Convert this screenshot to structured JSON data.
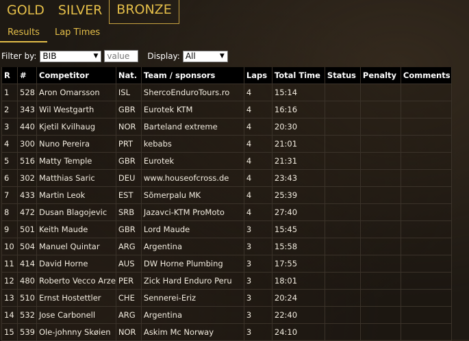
{
  "class_tabs": [
    "GOLD",
    "SILVER",
    "BRONZE"
  ],
  "active_class": "BRONZE",
  "sub_tabs": [
    "Results",
    "Lap Times"
  ],
  "filter": {
    "label": "Filter by:",
    "field_value": "BIB",
    "value_placeholder": "value",
    "display_label": "Display:",
    "display_value": "All"
  },
  "table": {
    "headers": [
      "R",
      "#",
      "Competitor",
      "Nat.",
      "Team / sponsors",
      "Laps",
      "Total Time",
      "Status",
      "Penalty",
      "Comments"
    ],
    "rows": [
      [
        "1",
        "528",
        "Aron Omarsson",
        "ISL",
        "ShercoEnduroTours.ro",
        "4",
        "15:14",
        "",
        "",
        ""
      ],
      [
        "2",
        "343",
        "Wil Westgarth",
        "GBR",
        "Eurotek KTM",
        "4",
        "16:16",
        "",
        "",
        ""
      ],
      [
        "3",
        "440",
        "Kjetil Kvilhaug",
        "NOR",
        "Barteland extreme",
        "4",
        "20:30",
        "",
        "",
        ""
      ],
      [
        "4",
        "300",
        "Nuno Pereira",
        "PRT",
        "kebabs",
        "4",
        "21:01",
        "",
        "",
        ""
      ],
      [
        "5",
        "516",
        "Matty Temple",
        "GBR",
        "Eurotek",
        "4",
        "21:31",
        "",
        "",
        ""
      ],
      [
        "6",
        "302",
        "Matthias Saric",
        "DEU",
        "www.houseofcross.de",
        "4",
        "23:43",
        "",
        "",
        ""
      ],
      [
        "7",
        "433",
        "Martin Leok",
        "EST",
        "Sõmerpalu MK",
        "4",
        "25:39",
        "",
        "",
        ""
      ],
      [
        "8",
        "472",
        "Dusan Blagojevic",
        "SRB",
        "Jazavci-KTM ProMoto",
        "4",
        "27:40",
        "",
        "",
        ""
      ],
      [
        "9",
        "501",
        "Keith Maude",
        "GBR",
        "Lord Maude",
        "3",
        "15:45",
        "",
        "",
        ""
      ],
      [
        "10",
        "504",
        "Manuel Quintar",
        "ARG",
        "Argentina",
        "3",
        "15:58",
        "",
        "",
        ""
      ],
      [
        "11",
        "414",
        "David Horne",
        "AUS",
        "DW Horne Plumbing",
        "3",
        "17:55",
        "",
        "",
        ""
      ],
      [
        "12",
        "480",
        "Roberto Vecco Arze",
        "PER",
        "Zick Hard Enduro Peru",
        "3",
        "18:01",
        "",
        "",
        ""
      ],
      [
        "13",
        "510",
        "Ernst Hostettler",
        "CHE",
        "Sennerei-Eriz",
        "3",
        "20:24",
        "",
        "",
        ""
      ],
      [
        "14",
        "532",
        "Jose Carbonell",
        "ARG",
        "Argentina",
        "3",
        "22:40",
        "",
        "",
        ""
      ],
      [
        "15",
        "539",
        "Ole-johnny Skøien",
        "NOR",
        "Askim Mc Norway",
        "3",
        "24:10",
        "",
        "",
        ""
      ]
    ]
  }
}
